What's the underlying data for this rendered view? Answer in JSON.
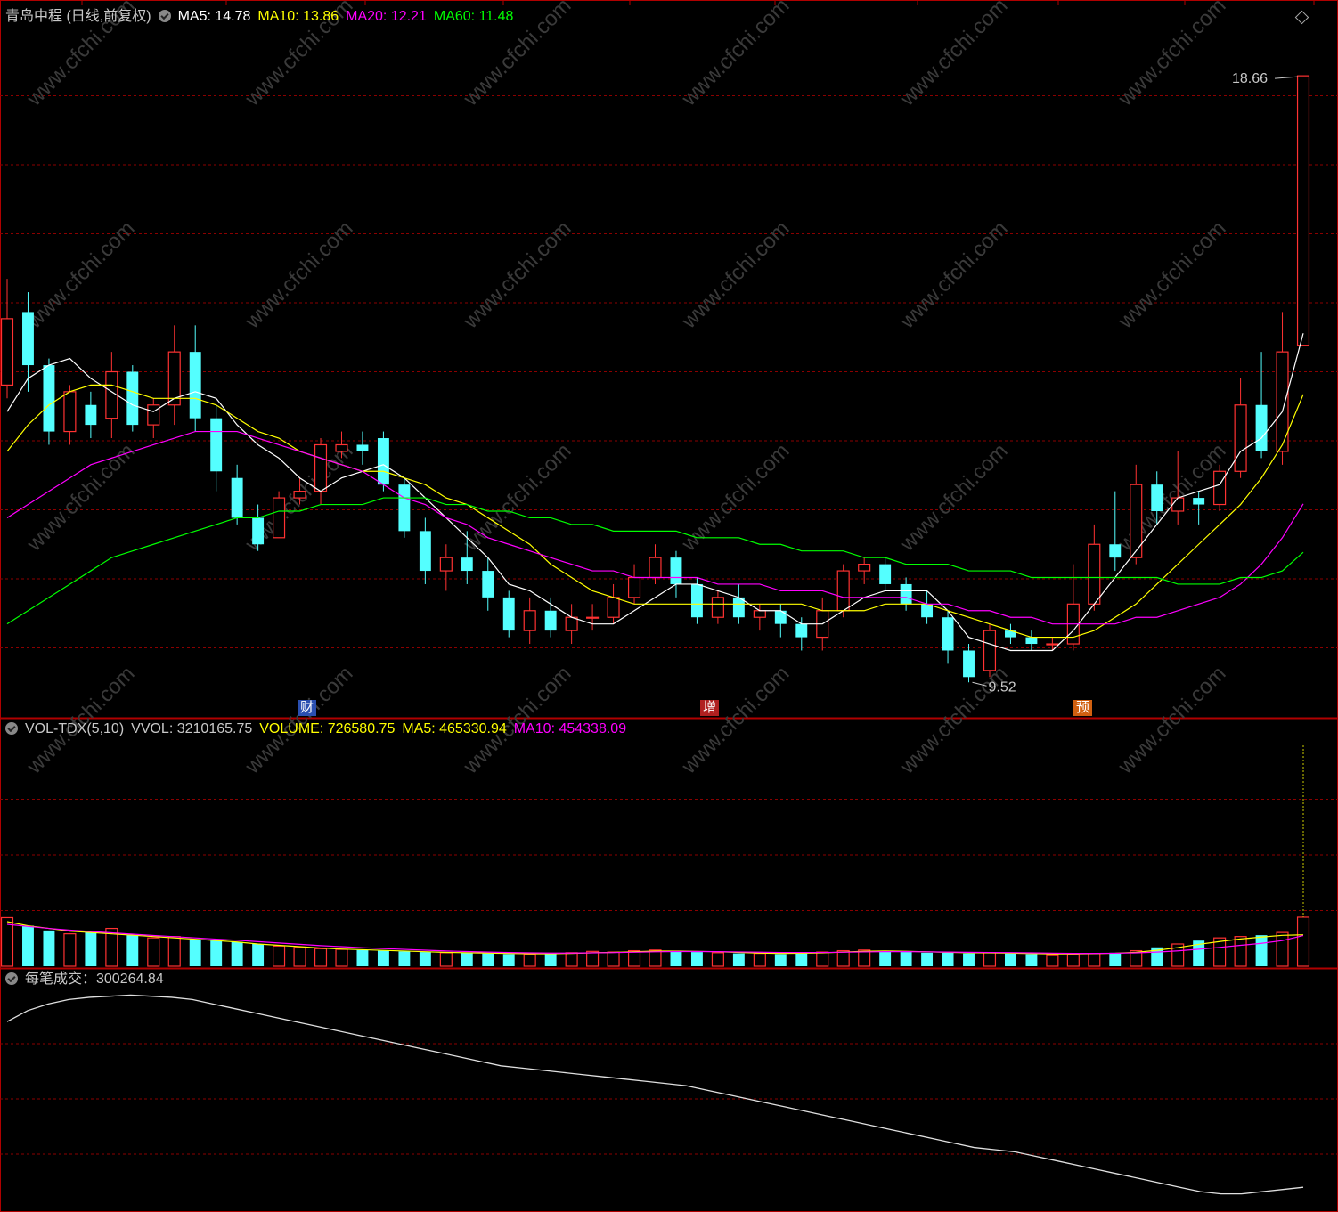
{
  "colors": {
    "up": "#ff3232",
    "down": "#54ffff",
    "ma5": "#ffffff",
    "ma10": "#ffff00",
    "ma20": "#ff00ff",
    "ma60": "#00ff00",
    "grid": "#8b0000",
    "border": "#b00000"
  },
  "price_panel": {
    "title": "青岛中程 (日线,前复权)",
    "indicators": [
      {
        "label": "MA5: 14.78",
        "color": "#ffffff"
      },
      {
        "label": "MA10: 13.86",
        "color": "#ffff00"
      },
      {
        "label": "MA20: 12.21",
        "color": "#ff00ff"
      },
      {
        "label": "MA60: 11.48",
        "color": "#00ff00"
      }
    ],
    "high_label": "18.66",
    "low_label": "9.52",
    "event_badges": [
      {
        "text": "财",
        "color": "#2a4fb0"
      },
      {
        "text": "增",
        "color": "#b02020"
      },
      {
        "text": "预",
        "color": "#d06010"
      }
    ]
  },
  "volume_panel": {
    "indicators": [
      {
        "label": "VOL-TDX(5,10)",
        "color": "#c8c8c8"
      },
      {
        "label": "VVOL: 3210165.75",
        "color": "#c8c8c8"
      },
      {
        "label": "VOLUME: 726580.75",
        "color": "#ffff00"
      },
      {
        "label": "MA5: 465330.94",
        "color": "#ffff00"
      },
      {
        "label": "MA10: 454338.09",
        "color": "#ff00ff"
      }
    ]
  },
  "trade_panel": {
    "label": "每笔成交：300264.84",
    "color": "#c8c8c8"
  },
  "watermark": "www.cfchi.com",
  "chart_data": [
    {
      "type": "candlestick",
      "title": "青岛中程 (日线,前复权)",
      "ylim": [
        9.0,
        19.4
      ],
      "high": 18.66,
      "low": 9.52,
      "candles": [
        [
          14.0,
          15.0,
          13.8,
          15.6
        ],
        [
          15.1,
          14.3,
          13.9,
          15.4
        ],
        [
          14.3,
          13.3,
          13.1,
          14.4
        ],
        [
          13.3,
          13.9,
          13.1,
          14.0
        ],
        [
          13.7,
          13.4,
          13.2,
          13.9
        ],
        [
          13.5,
          14.2,
          13.2,
          14.5
        ],
        [
          14.2,
          13.4,
          13.3,
          14.3
        ],
        [
          13.4,
          13.7,
          13.2,
          13.8
        ],
        [
          13.7,
          14.5,
          13.4,
          14.9
        ],
        [
          14.5,
          13.5,
          13.3,
          14.9
        ],
        [
          13.5,
          12.7,
          12.4,
          13.7
        ],
        [
          12.6,
          12.0,
          11.9,
          12.8
        ],
        [
          12.0,
          11.6,
          11.5,
          12.2
        ],
        [
          11.7,
          12.3,
          11.7,
          12.4
        ],
        [
          12.3,
          12.4,
          12.2,
          12.6
        ],
        [
          12.4,
          13.1,
          12.2,
          13.2
        ],
        [
          13.0,
          13.1,
          12.9,
          13.3
        ],
        [
          13.1,
          13.0,
          12.8,
          13.3
        ],
        [
          13.2,
          12.5,
          12.4,
          13.3
        ],
        [
          12.5,
          11.8,
          11.7,
          12.6
        ],
        [
          11.8,
          11.2,
          11.0,
          12.0
        ],
        [
          11.2,
          11.4,
          10.9,
          11.6
        ],
        [
          11.4,
          11.2,
          11.0,
          11.8
        ],
        [
          11.2,
          10.8,
          10.6,
          11.4
        ],
        [
          10.8,
          10.3,
          10.2,
          10.9
        ],
        [
          10.3,
          10.6,
          10.1,
          10.8
        ],
        [
          10.6,
          10.3,
          10.2,
          10.8
        ],
        [
          10.3,
          10.5,
          10.1,
          10.7
        ],
        [
          10.5,
          10.5,
          10.3,
          10.7
        ],
        [
          10.5,
          10.8,
          10.4,
          11.0
        ],
        [
          10.8,
          11.1,
          10.7,
          11.3
        ],
        [
          11.1,
          11.4,
          11.0,
          11.6
        ],
        [
          11.4,
          11.0,
          10.8,
          11.5
        ],
        [
          11.0,
          10.5,
          10.4,
          11.1
        ],
        [
          10.5,
          10.8,
          10.4,
          10.9
        ],
        [
          10.8,
          10.5,
          10.4,
          11.0
        ],
        [
          10.5,
          10.6,
          10.3,
          10.7
        ],
        [
          10.6,
          10.4,
          10.2,
          10.7
        ],
        [
          10.4,
          10.2,
          10.0,
          10.5
        ],
        [
          10.2,
          10.6,
          10.0,
          10.8
        ],
        [
          10.6,
          11.2,
          10.5,
          11.3
        ],
        [
          11.2,
          11.3,
          11.0,
          11.4
        ],
        [
          11.3,
          11.0,
          10.9,
          11.4
        ],
        [
          11.0,
          10.7,
          10.6,
          11.1
        ],
        [
          10.7,
          10.5,
          10.4,
          10.9
        ],
        [
          10.5,
          10.0,
          9.8,
          10.6
        ],
        [
          10.0,
          9.6,
          9.52,
          10.1
        ],
        [
          9.7,
          10.3,
          9.6,
          10.4
        ],
        [
          10.3,
          10.2,
          10.1,
          10.4
        ],
        [
          10.2,
          10.1,
          10.0,
          10.3
        ],
        [
          10.1,
          10.1,
          10.0,
          10.2
        ],
        [
          10.1,
          10.7,
          10.0,
          11.3
        ],
        [
          10.7,
          11.6,
          10.6,
          11.9
        ],
        [
          11.6,
          11.4,
          11.2,
          12.4
        ],
        [
          11.4,
          12.5,
          11.3,
          12.8
        ],
        [
          12.5,
          12.1,
          11.9,
          12.7
        ],
        [
          12.1,
          12.3,
          11.9,
          13.0
        ],
        [
          12.3,
          12.2,
          11.9,
          12.4
        ],
        [
          12.2,
          12.7,
          12.1,
          12.8
        ],
        [
          12.7,
          13.7,
          12.6,
          14.1
        ],
        [
          13.7,
          13.0,
          12.9,
          14.5
        ],
        [
          13.0,
          14.5,
          12.8,
          15.1
        ],
        [
          14.6,
          18.66,
          14.6,
          18.66
        ]
      ],
      "ma": [
        {
          "period": 5,
          "values": [
            13.6,
            14.1,
            14.3,
            14.4,
            14.1,
            13.9,
            13.7,
            13.6,
            13.8,
            13.9,
            13.8,
            13.4,
            13.1,
            12.9,
            12.6,
            12.4,
            12.6,
            12.7,
            12.8,
            12.6,
            12.3,
            12.0,
            11.7,
            11.4,
            11.0,
            10.9,
            10.7,
            10.5,
            10.4,
            10.4,
            10.6,
            10.8,
            11.0,
            11.0,
            10.9,
            10.8,
            10.6,
            10.6,
            10.4,
            10.4,
            10.6,
            10.8,
            10.9,
            10.9,
            10.9,
            10.6,
            10.2,
            10.1,
            10.0,
            10.0,
            10.0,
            10.3,
            10.7,
            11.1,
            11.5,
            11.9,
            12.3,
            12.4,
            12.5,
            13.0,
            13.2,
            13.6,
            14.78
          ]
        },
        {
          "period": 10,
          "values": [
            13.0,
            13.4,
            13.7,
            13.9,
            14.0,
            14.0,
            13.9,
            13.8,
            13.8,
            13.8,
            13.7,
            13.5,
            13.3,
            13.2,
            13.0,
            12.9,
            12.8,
            12.7,
            12.7,
            12.6,
            12.5,
            12.3,
            12.2,
            12.0,
            11.8,
            11.6,
            11.3,
            11.1,
            10.9,
            10.8,
            10.7,
            10.7,
            10.7,
            10.7,
            10.7,
            10.7,
            10.7,
            10.7,
            10.7,
            10.6,
            10.6,
            10.6,
            10.7,
            10.7,
            10.7,
            10.6,
            10.5,
            10.4,
            10.3,
            10.2,
            10.2,
            10.2,
            10.3,
            10.5,
            10.7,
            11.0,
            11.3,
            11.6,
            11.9,
            12.2,
            12.6,
            13.1,
            13.86
          ]
        },
        {
          "period": 20,
          "values": [
            12.0,
            12.2,
            12.4,
            12.6,
            12.8,
            12.9,
            13.0,
            13.1,
            13.2,
            13.3,
            13.3,
            13.3,
            13.2,
            13.1,
            13.0,
            12.9,
            12.8,
            12.7,
            12.5,
            12.3,
            12.2,
            12.0,
            11.9,
            11.7,
            11.6,
            11.5,
            11.4,
            11.3,
            11.2,
            11.2,
            11.1,
            11.1,
            11.1,
            11.1,
            11.0,
            11.0,
            11.0,
            10.9,
            10.9,
            10.9,
            10.8,
            10.8,
            10.8,
            10.8,
            10.7,
            10.7,
            10.6,
            10.6,
            10.5,
            10.5,
            10.4,
            10.4,
            10.4,
            10.4,
            10.5,
            10.5,
            10.6,
            10.7,
            10.8,
            11.0,
            11.3,
            11.7,
            12.21
          ]
        },
        {
          "period": 60,
          "values": [
            10.4,
            10.6,
            10.8,
            11.0,
            11.2,
            11.4,
            11.5,
            11.6,
            11.7,
            11.8,
            11.9,
            12.0,
            12.0,
            12.1,
            12.1,
            12.2,
            12.2,
            12.2,
            12.3,
            12.3,
            12.3,
            12.2,
            12.2,
            12.1,
            12.1,
            12.0,
            12.0,
            11.9,
            11.9,
            11.8,
            11.8,
            11.8,
            11.8,
            11.7,
            11.7,
            11.7,
            11.6,
            11.6,
            11.5,
            11.5,
            11.5,
            11.4,
            11.4,
            11.3,
            11.3,
            11.3,
            11.2,
            11.2,
            11.2,
            11.1,
            11.1,
            11.1,
            11.1,
            11.1,
            11.1,
            11.1,
            11.0,
            11.0,
            11.0,
            11.1,
            11.1,
            11.2,
            11.48
          ]
        }
      ]
    },
    {
      "type": "bar",
      "title": "VOL-TDX(5,10)",
      "ylim": [
        0,
        3300000
      ],
      "values": [
        720000,
        600000,
        530000,
        480000,
        500000,
        560000,
        460000,
        420000,
        440000,
        400000,
        380000,
        360000,
        330000,
        300000,
        280000,
        260000,
        250000,
        240000,
        230000,
        220000,
        210000,
        200000,
        200000,
        190000,
        180000,
        180000,
        190000,
        200000,
        220000,
        210000,
        230000,
        240000,
        220000,
        210000,
        200000,
        190000,
        190000,
        180000,
        200000,
        210000,
        230000,
        240000,
        220000,
        210000,
        200000,
        200000,
        190000,
        200000,
        190000,
        180000,
        170000,
        180000,
        190000,
        200000,
        230000,
        280000,
        330000,
        380000,
        420000,
        440000,
        460000,
        500000,
        726580.75
      ],
      "ma5": [
        660000,
        600000,
        560000,
        520000,
        500000,
        480000,
        460000,
        440000,
        420000,
        400000,
        380000,
        360000,
        330000,
        310000,
        290000,
        270000,
        255000,
        245000,
        235000,
        225000,
        215000,
        205000,
        200000,
        195000,
        190000,
        185000,
        185000,
        190000,
        200000,
        205000,
        215000,
        225000,
        225000,
        220000,
        215000,
        205000,
        195000,
        190000,
        192000,
        198000,
        210000,
        222000,
        226000,
        222000,
        214000,
        206000,
        200000,
        198000,
        194000,
        188000,
        182000,
        182000,
        186000,
        192000,
        206000,
        236000,
        276000,
        324000,
        366000,
        404000,
        432000,
        458000,
        465330.94
      ],
      "ma10": [
        620000,
        590000,
        560000,
        535000,
        515000,
        495000,
        475000,
        455000,
        438000,
        420000,
        402000,
        385000,
        365000,
        345000,
        325000,
        305000,
        290000,
        275000,
        262000,
        250000,
        238000,
        226000,
        218000,
        210000,
        203000,
        198000,
        195000,
        195000,
        198000,
        202000,
        207000,
        214000,
        218000,
        218000,
        216000,
        212000,
        208000,
        204000,
        204000,
        204000,
        207000,
        212000,
        216000,
        216000,
        214000,
        210000,
        206000,
        204000,
        202000,
        198000,
        194000,
        190000,
        190000,
        192000,
        198000,
        210000,
        228000,
        252000,
        280000,
        310000,
        340000,
        380000,
        454338.09
      ]
    },
    {
      "type": "line",
      "title": "每笔成交",
      "ylim": [
        0,
        1
      ],
      "values": [
        0.85,
        0.9,
        0.93,
        0.95,
        0.96,
        0.965,
        0.97,
        0.965,
        0.96,
        0.95,
        0.93,
        0.91,
        0.89,
        0.87,
        0.85,
        0.83,
        0.81,
        0.79,
        0.77,
        0.75,
        0.73,
        0.71,
        0.69,
        0.67,
        0.65,
        0.64,
        0.63,
        0.62,
        0.61,
        0.6,
        0.59,
        0.58,
        0.57,
        0.56,
        0.54,
        0.52,
        0.5,
        0.48,
        0.46,
        0.44,
        0.42,
        0.4,
        0.38,
        0.36,
        0.34,
        0.32,
        0.3,
        0.28,
        0.27,
        0.26,
        0.24,
        0.22,
        0.2,
        0.18,
        0.16,
        0.14,
        0.12,
        0.1,
        0.08,
        0.07,
        0.07,
        0.08,
        0.09,
        0.1
      ]
    }
  ]
}
